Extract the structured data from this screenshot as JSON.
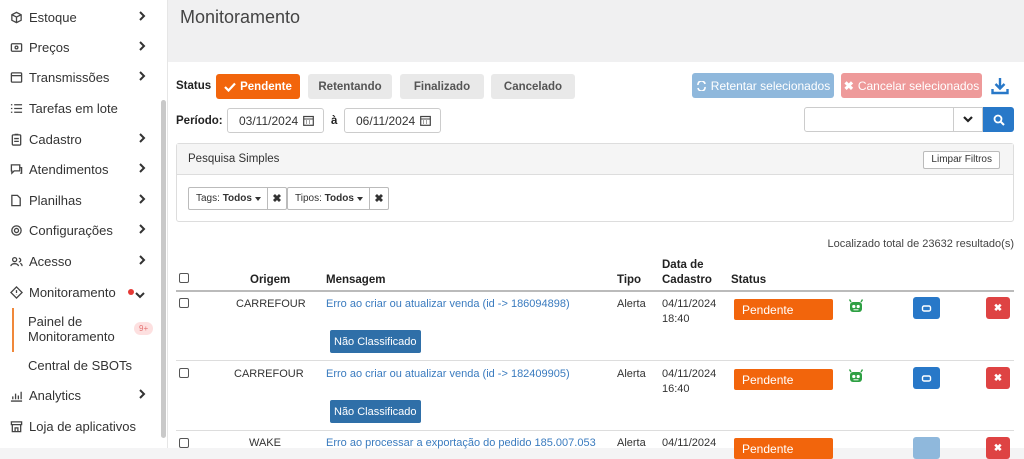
{
  "sidebar": {
    "items": [
      {
        "label": "Estoque",
        "icon": "box-icon"
      },
      {
        "label": "Preços",
        "icon": "price-tag-icon"
      },
      {
        "label": "Transmissões",
        "icon": "store-icon"
      },
      {
        "label": "Tarefas em lote",
        "icon": "list-icon"
      },
      {
        "label": "Cadastro",
        "icon": "clipboard-icon"
      },
      {
        "label": "Atendimentos",
        "icon": "chat-icon"
      },
      {
        "label": "Planilhas",
        "icon": "spreadsheet-icon"
      },
      {
        "label": "Configurações",
        "icon": "gear-icon"
      },
      {
        "label": "Acesso",
        "icon": "users-icon"
      },
      {
        "label": "Monitoramento",
        "icon": "alert-diamond-icon"
      },
      {
        "label": "Analytics",
        "icon": "bar-chart-icon"
      },
      {
        "label": "Loja de aplicativos",
        "icon": "store-front-icon"
      }
    ],
    "submenu": {
      "painel_line1": "Painel de",
      "painel_line2": "Monitoramento",
      "painel_badge": "9+",
      "central": "Central de SBOTs"
    }
  },
  "header": {
    "title": "Monitoramento"
  },
  "status_filter": {
    "label": "Status",
    "buttons": [
      "Pendente",
      "Retentando",
      "Finalizado",
      "Cancelado"
    ]
  },
  "actions": {
    "retry_selected": "Retentar selecionados",
    "cancel_selected": "Cancelar selecionados"
  },
  "period": {
    "label": "Período:",
    "from": "03/11/2024",
    "separator": "à",
    "to": "06/11/2024"
  },
  "filters": {
    "title": "Pesquisa Simples",
    "clear": "Limpar Filtros",
    "tags_label": "Tags:",
    "tags_value": "Todos",
    "tipos_label": "Tipos:",
    "tipos_value": "Todos"
  },
  "results_text": "Localizado total de 23632 resultado(s)",
  "table": {
    "headers": {
      "origem": "Origem",
      "mensagem": "Mensagem",
      "tipo": "Tipo",
      "data_line1": "Data de",
      "data_line2": "Cadastro",
      "status": "Status"
    },
    "rows": [
      {
        "origem": "CARREFOUR",
        "mensagem": "Erro ao criar ou atualizar venda (id -> 186094898)",
        "tag": "Não Classificado",
        "tipo": "Alerta",
        "date": "04/11/2024",
        "time": "18:40",
        "status": "Pendente"
      },
      {
        "origem": "CARREFOUR",
        "mensagem": "Erro ao criar ou atualizar venda (id -> 182409905)",
        "tag": "Não Classificado",
        "tipo": "Alerta",
        "date": "04/11/2024",
        "time": "16:40",
        "status": "Pendente"
      },
      {
        "origem": "WAKE",
        "mensagem": "Erro ao processar a exportação do pedido 185.007.053",
        "tipo": "Alerta",
        "date": "04/11/2024",
        "status": "Pendente"
      }
    ]
  },
  "colors": {
    "accent_orange": "#f2650c",
    "primary_blue": "#2878c8",
    "danger_red": "#de4343",
    "tag_blue": "#2f6fa8",
    "robot_green": "#2ea043"
  }
}
